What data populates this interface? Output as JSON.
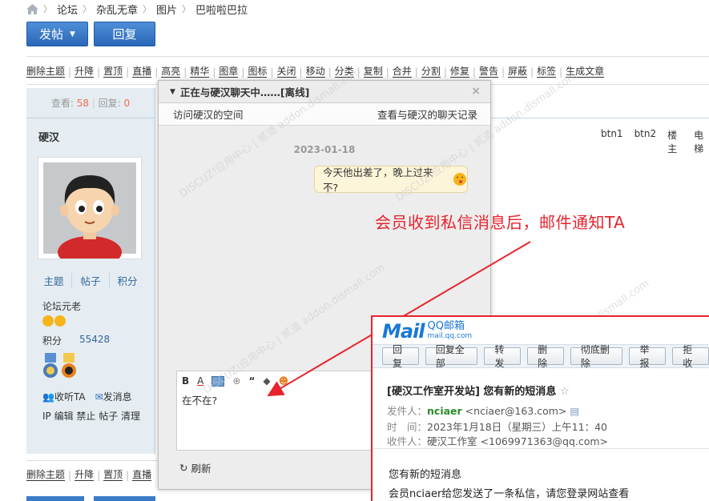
{
  "breadcrumb": {
    "items": [
      "论坛",
      "杂乱无章",
      "图片",
      "巴啦啦巴拉"
    ]
  },
  "toolbar": {
    "post_label": "发帖",
    "reply_label": "回复"
  },
  "mod_actions": [
    "删除主题",
    "升降",
    "置顶",
    "直播",
    "高亮",
    "精华",
    "图章",
    "图标",
    "关闭",
    "移动",
    "分类",
    "复制",
    "合并",
    "分割",
    "修复",
    "警告",
    "屏蔽",
    "标签",
    "生成文章"
  ],
  "mod_actions_bottom": [
    "删除主题",
    "升降",
    "置顶",
    "直播"
  ],
  "stats": {
    "views_label": "查看:",
    "views": "58",
    "replies_label": "回复:",
    "replies": "0"
  },
  "author": {
    "name": "硬汉",
    "links": [
      "主题",
      "帖子",
      "积分"
    ],
    "rank": "论坛元老",
    "points_label": "积分",
    "points": "55428",
    "follow_label": "收听TA",
    "message_label": "发消息",
    "ip_line": "IP 编辑 禁止 帖子 清理"
  },
  "post_buttons": [
    "btn1",
    "btn2",
    "楼主",
    "电梯"
  ],
  "chat": {
    "title": "正在与硬汉聊天中……[离线]",
    "visit_space": "访问硬汉的空间",
    "view_history": "查看与硬汉的聊天记录",
    "date": "2023-01-18",
    "message": "今天他出差了，晚上过来不?",
    "input_text": "在不在?",
    "refresh_label": "刷新"
  },
  "annotation": "会员收到私信消息后，邮件通知TA",
  "watermark": "DISCUZ!应用中心 | 贰道 addon.dismall.com",
  "mail": {
    "brand": "QQ邮箱",
    "brand_domain": "mail.qq.com",
    "logo_text": "Mail",
    "buttons": [
      "回复",
      "回复全部",
      "转发",
      "删除",
      "彻底删除",
      "举报",
      "拒收"
    ],
    "subject": "[硬汉工作室开发站] 您有新的短消息",
    "from_label": "发件人：",
    "from_name": "nciaer",
    "from_addr": "<nciaer@163.com>",
    "time_label": "时　间：",
    "time_value": "2023年1月18日（星期三）上午11：40",
    "to_label": "收件人：",
    "to_name": "硬汉工作室",
    "to_addr": "<1069971363@qq.com>",
    "body_line1": "您有新的短消息",
    "body_line2": "会员nciaer给您发送了一条私信，请您登录网站查看"
  },
  "colors": {
    "accent": "#2a68b8",
    "alert": "#e8232d",
    "highlight": "#f26c4f"
  }
}
